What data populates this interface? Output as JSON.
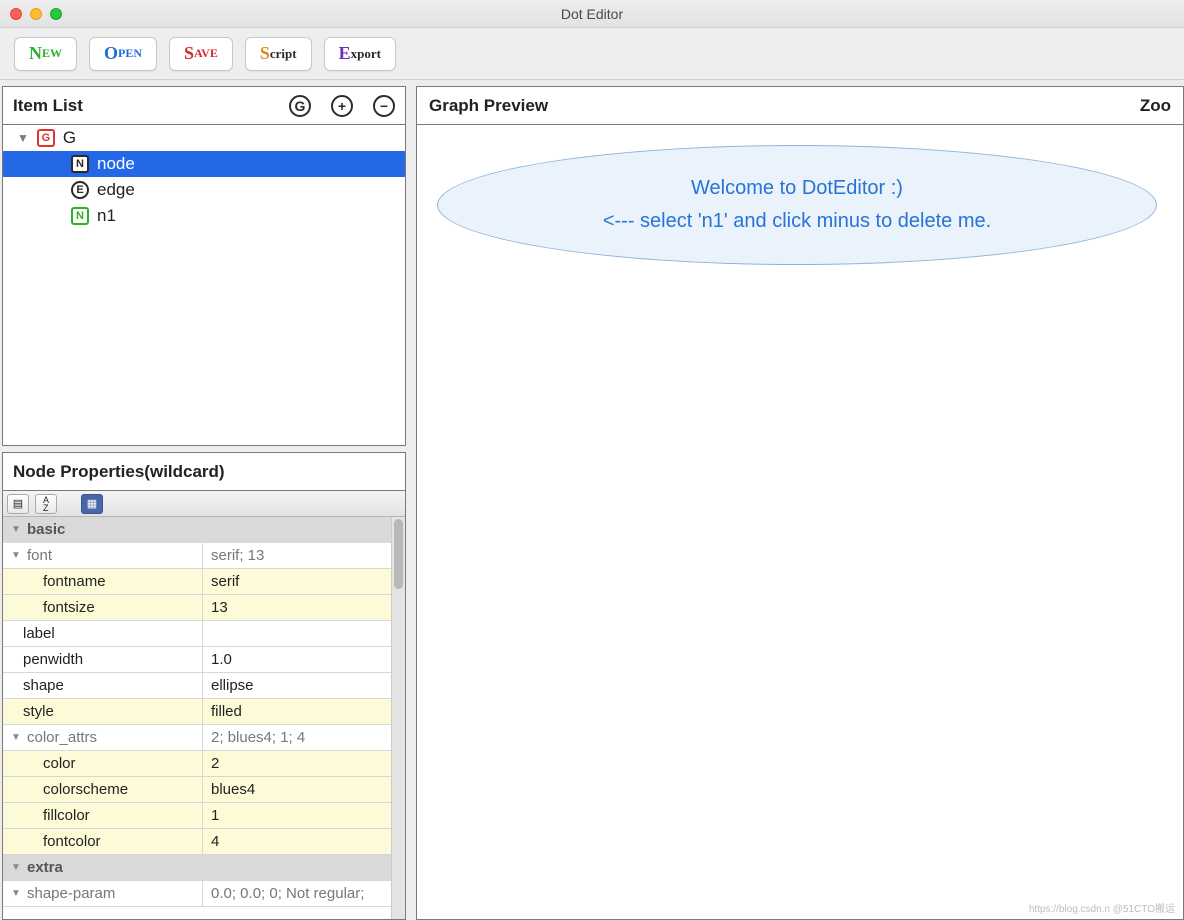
{
  "window": {
    "title": "Dot Editor"
  },
  "toolbar": {
    "new": {
      "first": "N",
      "rest": "EW",
      "color": "#2bb02b"
    },
    "open": {
      "first": "O",
      "rest": "PEN",
      "color": "#1f6fd6"
    },
    "save": {
      "first": "S",
      "rest": "AVE",
      "color": "#d62a2a"
    },
    "script": {
      "first": "S",
      "rest": "cript",
      "color": "#e08a1c"
    },
    "export": {
      "first": "E",
      "rest": "xport",
      "color": "#6b2fbf"
    }
  },
  "itemlist": {
    "title": "Item List",
    "g_btn": "G",
    "tree": [
      {
        "kind": "g",
        "label": "G",
        "sel": false,
        "depth": 0,
        "hasDisc": true
      },
      {
        "kind": "n",
        "label": "node",
        "sel": true,
        "depth": 1,
        "hasDisc": false
      },
      {
        "kind": "e",
        "label": "edge",
        "sel": false,
        "depth": 1,
        "hasDisc": false
      },
      {
        "kind": "ng",
        "label": "n1",
        "sel": false,
        "depth": 1,
        "hasDisc": false
      }
    ]
  },
  "props": {
    "title": "Node Properties(wildcard)",
    "rows": [
      {
        "type": "cat",
        "k": "basic",
        "v": ""
      },
      {
        "type": "group",
        "k": "font",
        "v": "serif; 13",
        "indent": 0
      },
      {
        "type": "hl",
        "k": "fontname",
        "v": "serif",
        "indent": 2
      },
      {
        "type": "hl",
        "k": "fontsize",
        "v": "13",
        "indent": 2
      },
      {
        "type": "plain",
        "k": "label",
        "v": "",
        "indent": 0
      },
      {
        "type": "plain",
        "k": "penwidth",
        "v": "1.0",
        "indent": 0
      },
      {
        "type": "plain",
        "k": "shape",
        "v": "ellipse",
        "indent": 0
      },
      {
        "type": "hl",
        "k": "style",
        "v": "filled",
        "indent": 0
      },
      {
        "type": "group",
        "k": "color_attrs",
        "v": "2; blues4; 1; 4",
        "indent": 0
      },
      {
        "type": "hl",
        "k": "color",
        "v": "2",
        "indent": 2
      },
      {
        "type": "hl",
        "k": "colorscheme",
        "v": "blues4",
        "indent": 2
      },
      {
        "type": "hl",
        "k": "fillcolor",
        "v": "1",
        "indent": 2
      },
      {
        "type": "hl",
        "k": "fontcolor",
        "v": "4",
        "indent": 2
      },
      {
        "type": "cat",
        "k": "extra",
        "v": ""
      },
      {
        "type": "group",
        "k": "shape-param",
        "v": "0.0; 0.0; 0; Not regular; ",
        "indent": 0
      }
    ]
  },
  "preview": {
    "title": "Graph Preview",
    "zoomLabel": "Zoo",
    "bubble": {
      "line1": "Welcome to DotEditor :)",
      "line2": "<--- select 'n1' and click minus to delete me."
    }
  },
  "watermark": "https://blog.csdn.n @51CTO搬运"
}
